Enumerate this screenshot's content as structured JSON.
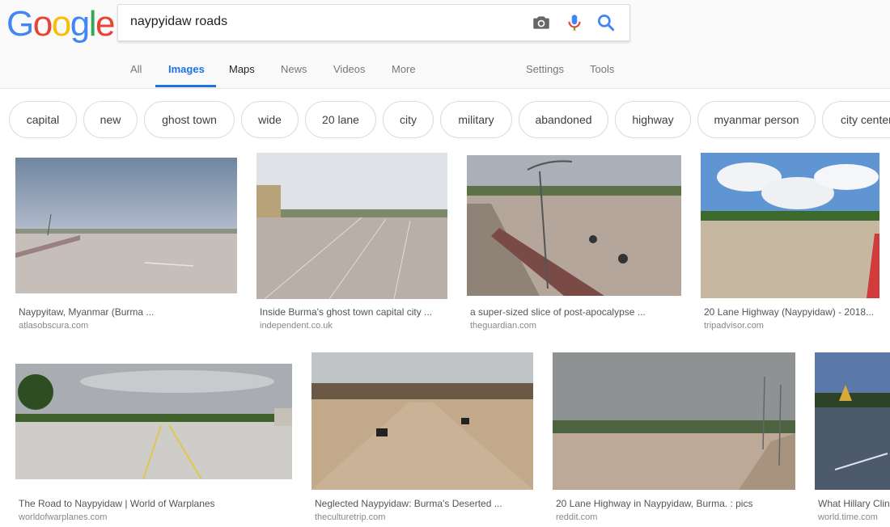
{
  "logo": {
    "letters": [
      "G",
      "o",
      "o",
      "g",
      "l",
      "e"
    ]
  },
  "search": {
    "query": "naypyidaw roads"
  },
  "tabs": {
    "all": "All",
    "images": "Images",
    "maps": "Maps",
    "news": "News",
    "videos": "Videos",
    "more": "More",
    "settings": "Settings",
    "tools": "Tools"
  },
  "chips": [
    "capital",
    "new",
    "ghost town",
    "wide",
    "20 lane",
    "city",
    "military",
    "abandoned",
    "highway",
    "myanmar person",
    "city center"
  ],
  "results": [
    {
      "caption": "Naypyitaw, Myanmar (Burma ...",
      "source": "atlasobscura.com"
    },
    {
      "caption": "Inside Burma's ghost town capital city ...",
      "source": "independent.co.uk"
    },
    {
      "caption": "a super-sized slice of post-apocalypse ...",
      "source": "theguardian.com"
    },
    {
      "caption": "20 Lane Highway (Naypyidaw) - 2018...",
      "source": "tripadvisor.com"
    },
    {
      "caption": "The Road to Naypyidaw | World of Warplanes",
      "source": "worldofwarplanes.com"
    },
    {
      "caption": "Neglected Naypyidaw: Burma's Deserted ...",
      "source": "theculturetrip.com"
    },
    {
      "caption": "20 Lane Highway in Naypyidaw, Burma. : pics",
      "source": "reddit.com"
    },
    {
      "caption": "What Hillary Clin",
      "source": "world.time.com"
    }
  ],
  "colors": {
    "blue": "#4285f4",
    "red": "#ea4335",
    "yellow": "#fbbc05",
    "green": "#34a853",
    "active_tab": "#1a73e8"
  }
}
